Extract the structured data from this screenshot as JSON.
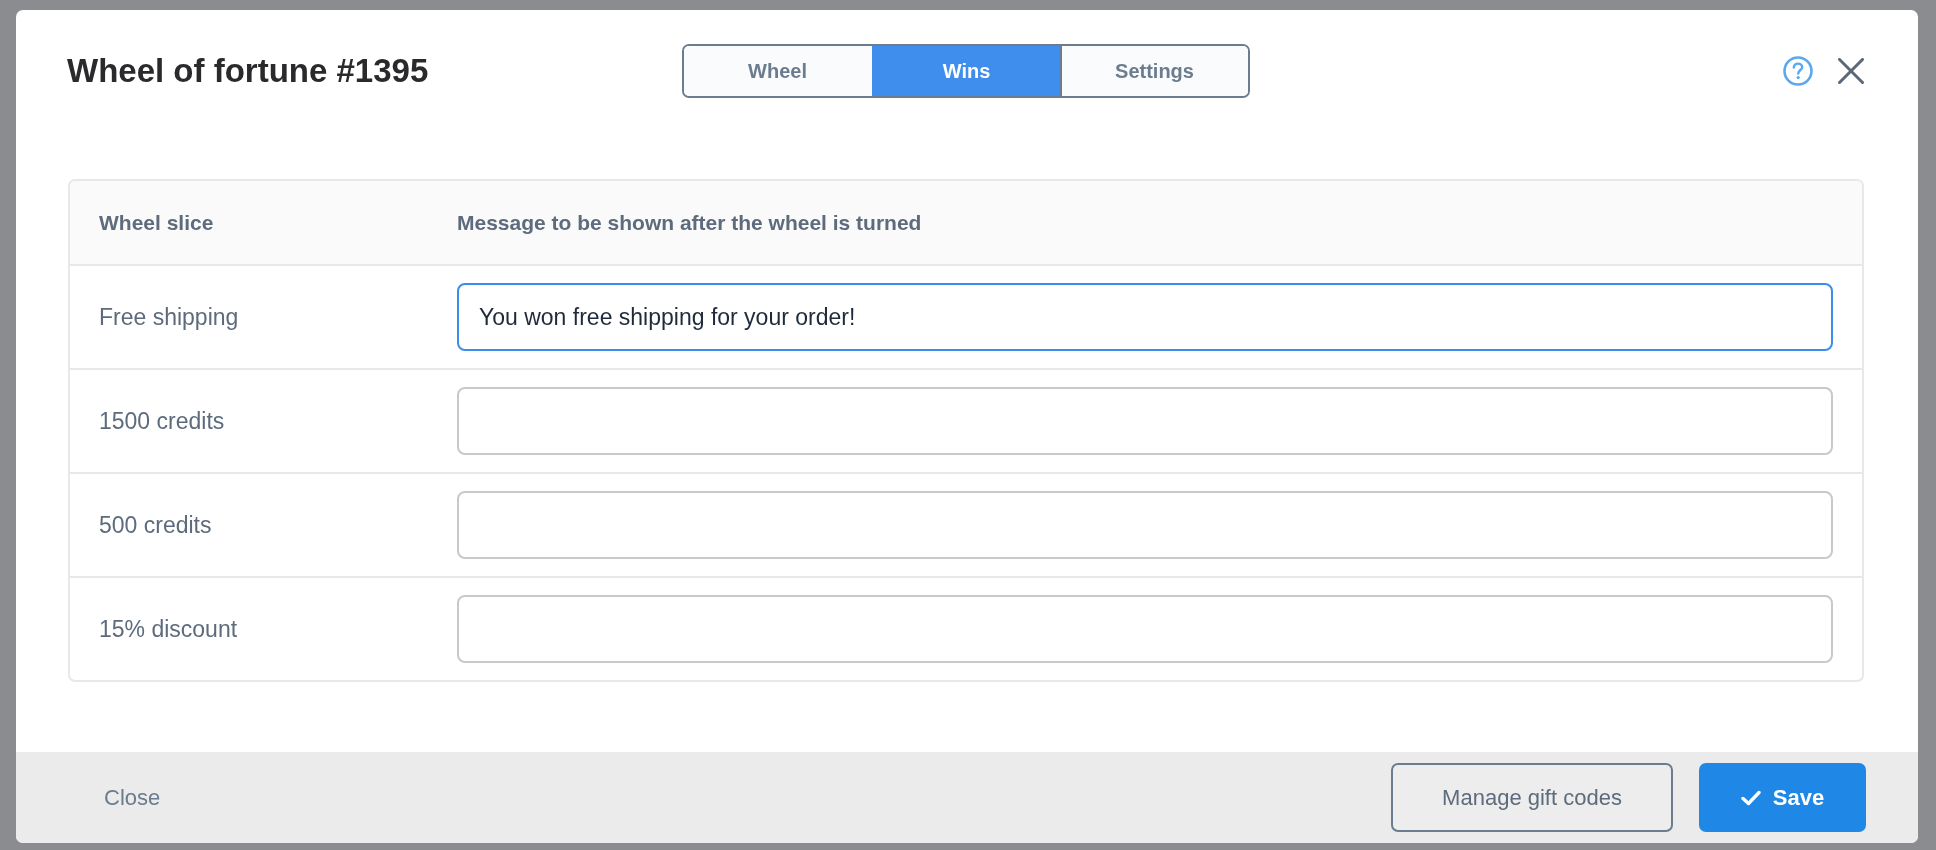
{
  "dialog": {
    "title": "Wheel of fortune #1395",
    "tabs": [
      {
        "label": "Wheel",
        "selected": false
      },
      {
        "label": "Wins",
        "selected": true
      },
      {
        "label": "Settings",
        "selected": false
      }
    ]
  },
  "table": {
    "columns": [
      "Wheel slice",
      "Message to be shown after the wheel is turned"
    ],
    "rows": [
      {
        "slice": "Free shipping",
        "message": "You won free shipping for your order!",
        "focused": true
      },
      {
        "slice": "1500 credits",
        "focused": false
      },
      {
        "slice": "500 credits",
        "focused": false
      },
      {
        "slice": "15% discount",
        "focused": false
      }
    ]
  },
  "footer": {
    "close_link": "Close",
    "buttons": [
      {
        "label": "Manage gift codes",
        "kind": "secondary"
      },
      {
        "label": "Save",
        "kind": "primary"
      }
    ]
  }
}
